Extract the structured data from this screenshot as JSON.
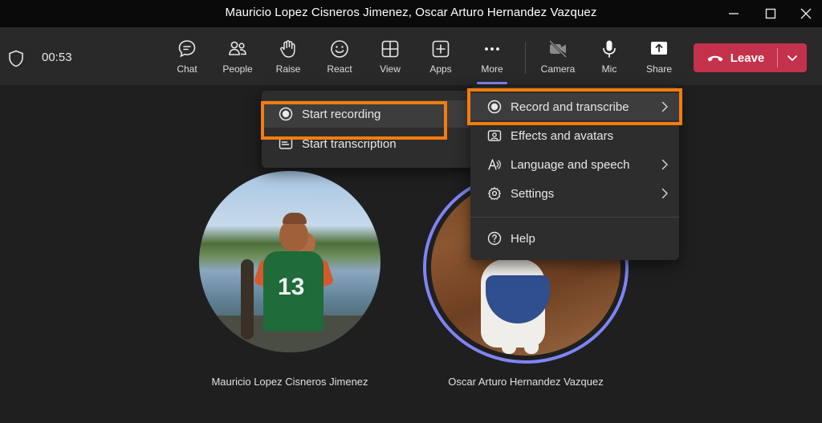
{
  "window": {
    "title": "Mauricio Lopez Cisneros Jimenez, Oscar Arturo Hernandez Vazquez"
  },
  "toolbar": {
    "timer": "00:53",
    "buttons": {
      "chat": "Chat",
      "people": "People",
      "raise": "Raise",
      "react": "React",
      "view": "View",
      "apps": "Apps",
      "more": "More",
      "camera": "Camera",
      "mic": "Mic",
      "share": "Share"
    },
    "leave_label": "Leave"
  },
  "more_menu": {
    "items": [
      {
        "label": "Record and transcribe",
        "icon": "record-icon",
        "has_submenu": true,
        "highlighted": true
      },
      {
        "label": "Effects and avatars",
        "icon": "effects-icon",
        "has_submenu": false
      },
      {
        "label": "Language and speech",
        "icon": "language-icon",
        "has_submenu": true
      },
      {
        "label": "Settings",
        "icon": "gear-icon",
        "has_submenu": true
      },
      {
        "label": "Help",
        "icon": "help-icon",
        "has_submenu": false
      }
    ]
  },
  "record_submenu": {
    "items": [
      {
        "label": "Start recording",
        "icon": "record-icon",
        "highlighted": true
      },
      {
        "label": "Start transcription",
        "icon": "transcript-icon"
      }
    ]
  },
  "participants": [
    {
      "name": "Mauricio Lopez Cisneros Jimenez",
      "jersey_number": "13"
    },
    {
      "name": "Oscar Arturo Hernandez Vazquez",
      "speaking": true
    }
  ],
  "colors": {
    "accent": "#7f85f5",
    "leave": "#c4314b",
    "annotation": "#f47c0e"
  }
}
